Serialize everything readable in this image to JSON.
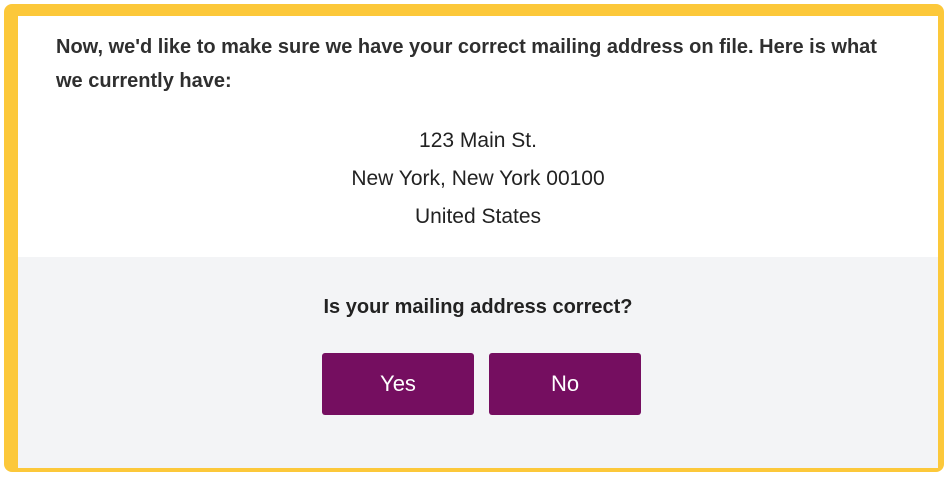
{
  "intro": {
    "text": "Now, we'd like to make sure we have your correct mailing address on file. Here is what we currently have:"
  },
  "address": {
    "street": "123 Main St.",
    "city_state_zip": "New York, New York 00100",
    "country": "United States"
  },
  "confirm": {
    "question": "Is your mailing address correct?",
    "yes_label": "Yes",
    "no_label": "No"
  },
  "colors": {
    "frame_border": "#fcc83a",
    "button_background": "#750e60",
    "panel_background": "#f3f4f6"
  }
}
